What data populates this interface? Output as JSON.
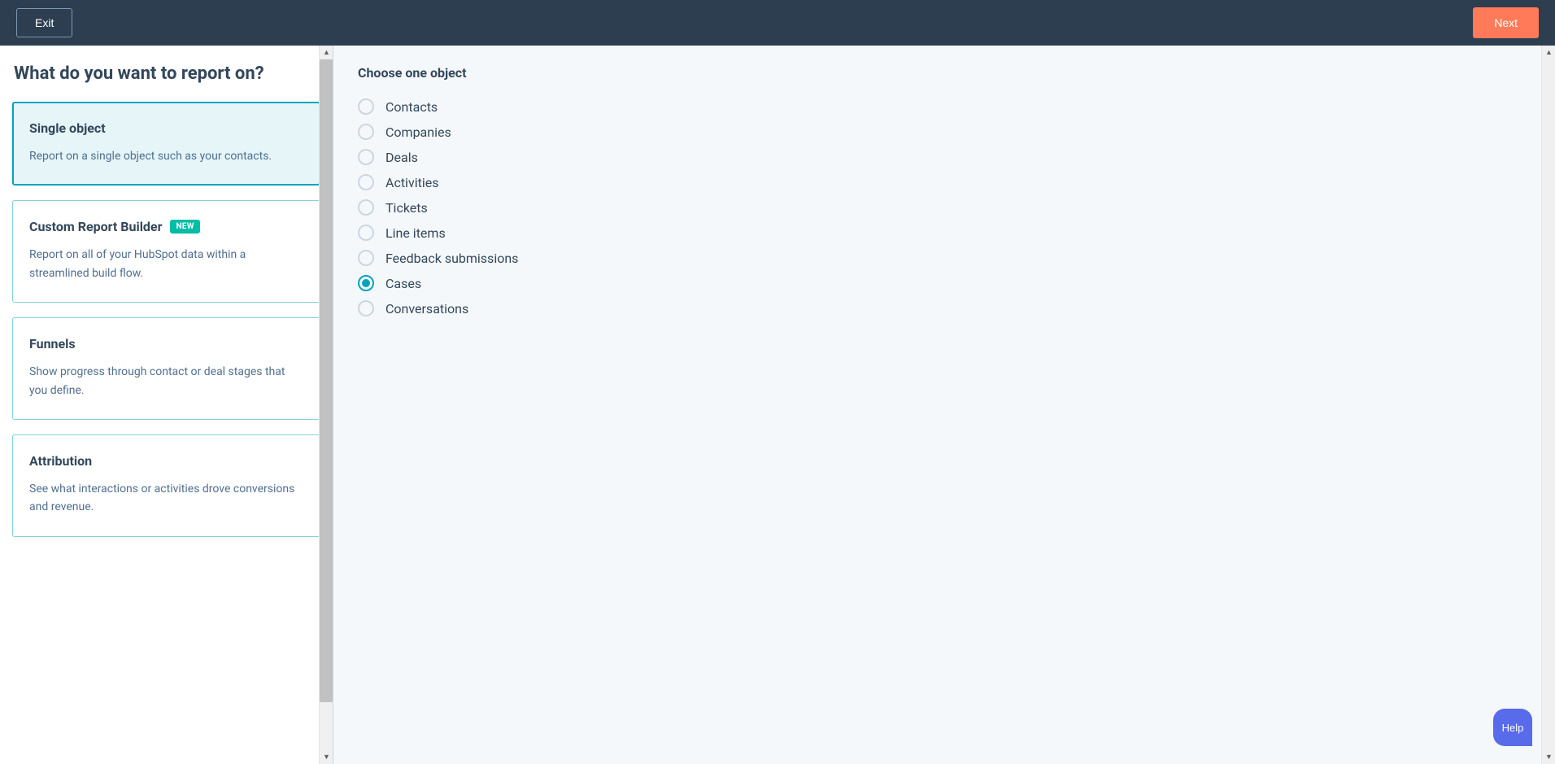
{
  "header": {
    "exit_label": "Exit",
    "next_label": "Next"
  },
  "sidebar": {
    "title": "What do you want to report on?",
    "options": [
      {
        "title": "Single object",
        "description": "Report on a single object such as your contacts.",
        "badge": null,
        "selected": true
      },
      {
        "title": "Custom Report Builder",
        "description": "Report on all of your HubSpot data within a streamlined build flow.",
        "badge": "NEW",
        "selected": false
      },
      {
        "title": "Funnels",
        "description": "Show progress through contact or deal stages that you define.",
        "badge": null,
        "selected": false
      },
      {
        "title": "Attribution",
        "description": "See what interactions or activities drove conversions and revenue.",
        "badge": null,
        "selected": false
      }
    ]
  },
  "main": {
    "title": "Choose one object",
    "objects": [
      {
        "label": "Contacts",
        "selected": false
      },
      {
        "label": "Companies",
        "selected": false
      },
      {
        "label": "Deals",
        "selected": false
      },
      {
        "label": "Activities",
        "selected": false
      },
      {
        "label": "Tickets",
        "selected": false
      },
      {
        "label": "Line items",
        "selected": false
      },
      {
        "label": "Feedback submissions",
        "selected": false
      },
      {
        "label": "Cases",
        "selected": true
      },
      {
        "label": "Conversations",
        "selected": false
      }
    ]
  },
  "help": {
    "label": "Help"
  }
}
